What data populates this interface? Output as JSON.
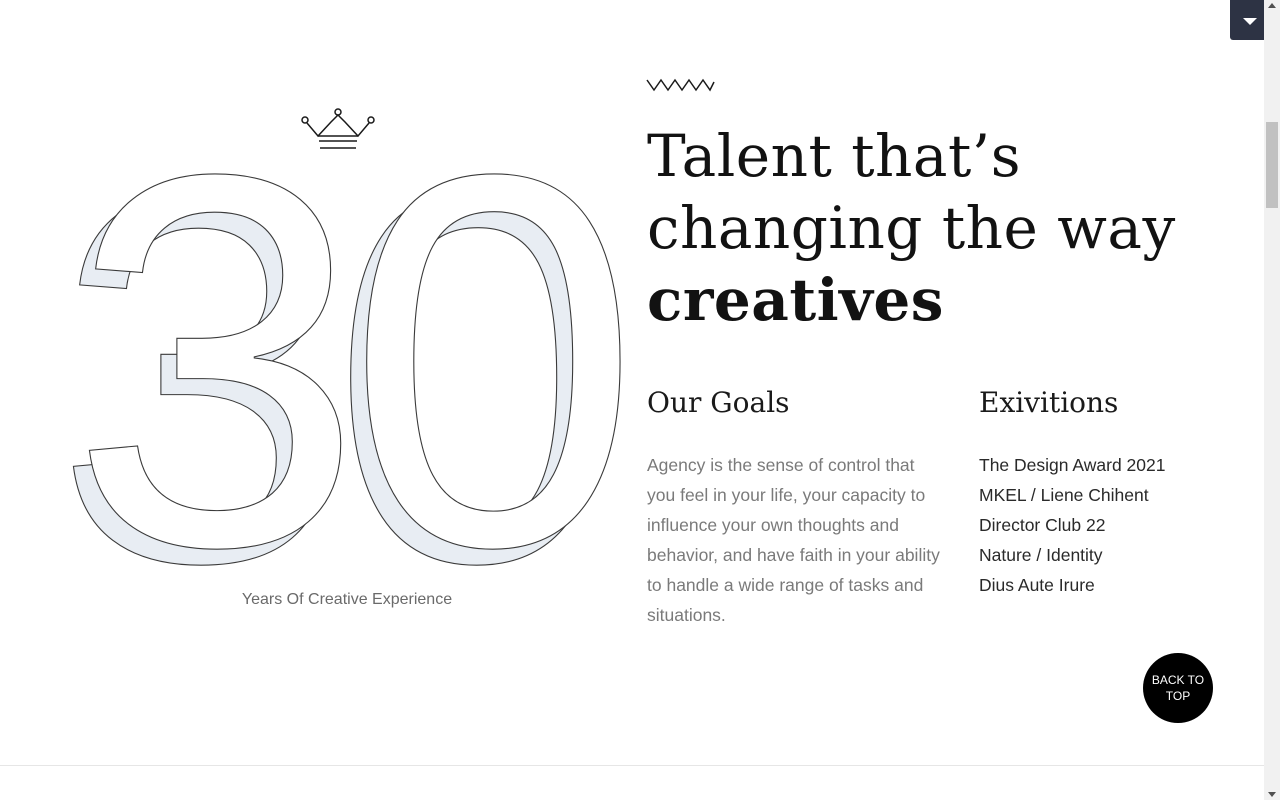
{
  "stat": {
    "number": "30",
    "caption": "Years Of Creative Experience"
  },
  "headline": {
    "line1": "Talent that’s",
    "line2": "changing the way",
    "line3": "creatives"
  },
  "goals": {
    "title": "Our Goals",
    "text": "Agency is the sense of control that you feel in your life, your capacity to influence your own thoughts and behavior, and have faith in your ability to handle a wide range of tasks and situations."
  },
  "exhibitions": {
    "title": "Exivitions",
    "items": [
      "The Design Award 2021",
      "MKEL / Liene Chihent",
      "Director Club 22",
      "Nature / Identity",
      "Dius Aute Irure"
    ]
  },
  "back_to_top": {
    "label": "BACK TO TOP"
  },
  "icons": {
    "crown": "crown-icon",
    "zigzag": "zigzag-icon",
    "menu": "chevron-down-icon"
  },
  "colors": {
    "number_fill": "#e8edf3",
    "number_stroke": "#3a3a3a",
    "menu_toggle": "#2d3344",
    "back_to_top": "#000000"
  }
}
